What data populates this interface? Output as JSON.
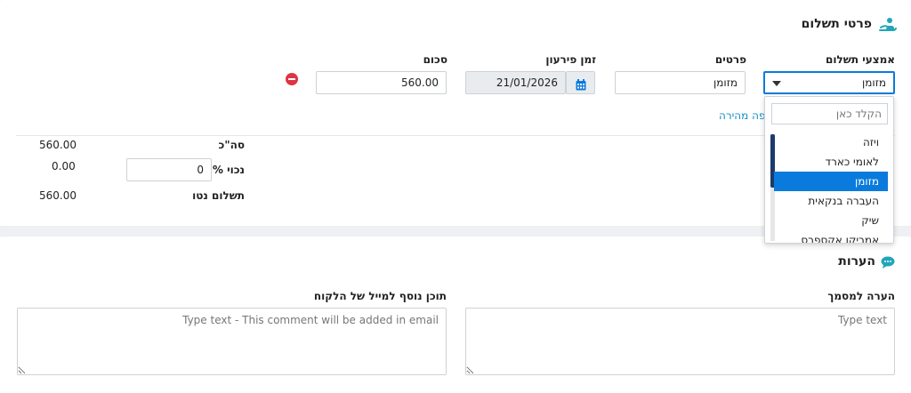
{
  "payment": {
    "section_title": "פרטי תשלום",
    "columns": {
      "method": "אמצעי תשלום",
      "details": "פרטים",
      "due_date": "זמן פירעון",
      "amount": "סכום"
    },
    "row": {
      "method": "מזומן",
      "details": "מזומן",
      "due_date": "21/01/2026",
      "amount": "560.00"
    },
    "quick_add_link": "הוספה מהירה",
    "dropdown": {
      "search_placeholder": "הקלד כאן",
      "options": [
        "ויזה",
        "לאומי כארד",
        "מזומן",
        "העברה בנקאית",
        "שיק",
        "אמריקן אקספרס"
      ],
      "selected": "מזומן"
    }
  },
  "summary": {
    "total_label": "סה\"כ",
    "total_value": "560.00",
    "discount_label": "נכוי %",
    "discount_value": "0",
    "discount_amount": "0.00",
    "net_label": "תשלום נטו",
    "net_value": "560.00"
  },
  "notes": {
    "section_title": "הערות",
    "doc_note_label": "הערה למסמך",
    "doc_note_placeholder": "Type text",
    "email_note_label": "תוכן נוסף למייל של הלקוח",
    "email_note_placeholder": "Type text - This comment will be added in email"
  },
  "colors": {
    "accent": "#0a7bdc",
    "link": "#1591bf",
    "danger": "#dc3545",
    "icon_teal": "#20a6b8"
  }
}
